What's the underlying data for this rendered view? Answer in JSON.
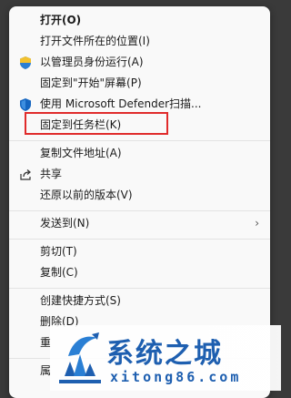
{
  "menu": {
    "items": [
      {
        "label": "打开(O)",
        "bold": true
      },
      {
        "label": "打开文件所在的位置(I)"
      },
      {
        "label": "以管理员身份运行(A)",
        "icon": "uac-shield-icon"
      },
      {
        "label": "固定到\"开始\"屏幕(P)"
      },
      {
        "label": "使用 Microsoft Defender扫描...",
        "icon": "defender-shield-icon"
      },
      {
        "label": "固定到任务栏(K)",
        "highlighted": true
      },
      {
        "label": "复制文件地址(A)"
      },
      {
        "label": "共享",
        "icon": "share-icon"
      },
      {
        "label": "还原以前的版本(V)"
      },
      {
        "label": "发送到(N)",
        "submenu": true
      },
      {
        "label": "剪切(T)"
      },
      {
        "label": "复制(C)"
      },
      {
        "label": "创建快捷方式(S)"
      },
      {
        "label": "删除(D)"
      },
      {
        "label": "重"
      },
      {
        "label": "属"
      }
    ],
    "submenu_chevron": "›"
  },
  "watermark": {
    "title": "系统之城",
    "url": "xitong86.com"
  },
  "colors": {
    "highlight_border": "#e02b2b",
    "watermark_blue": "#1e5fb0"
  }
}
